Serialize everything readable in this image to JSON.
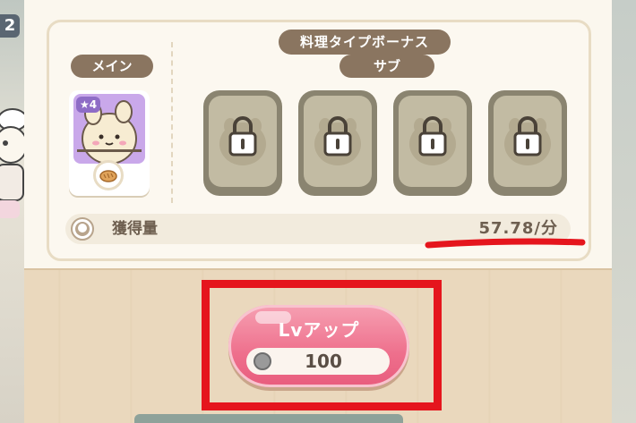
{
  "hud": {
    "level_number": "2"
  },
  "bonus_panel": {
    "title": "料理タイプボーナス",
    "main_label": "メイン",
    "sub_label": "サブ",
    "main_card": {
      "star_level": "4",
      "icon": "character-icon"
    },
    "sub_slots": [
      {
        "state": "locked",
        "icon": "lock-icon"
      },
      {
        "state": "locked",
        "icon": "lock-icon"
      },
      {
        "state": "locked",
        "icon": "lock-icon"
      },
      {
        "state": "locked",
        "icon": "lock-icon"
      }
    ],
    "gain": {
      "label": "獲得量",
      "value": "57.78/分"
    }
  },
  "level_up": {
    "label": "Lvアップ",
    "cost": "100",
    "cost_icon": "coin-icon"
  },
  "colors": {
    "panel_brown": "#8a7560",
    "button_pink": "#ee6f8c",
    "highlight_red": "#e5151d",
    "locked_slot": "#c2bba3"
  }
}
